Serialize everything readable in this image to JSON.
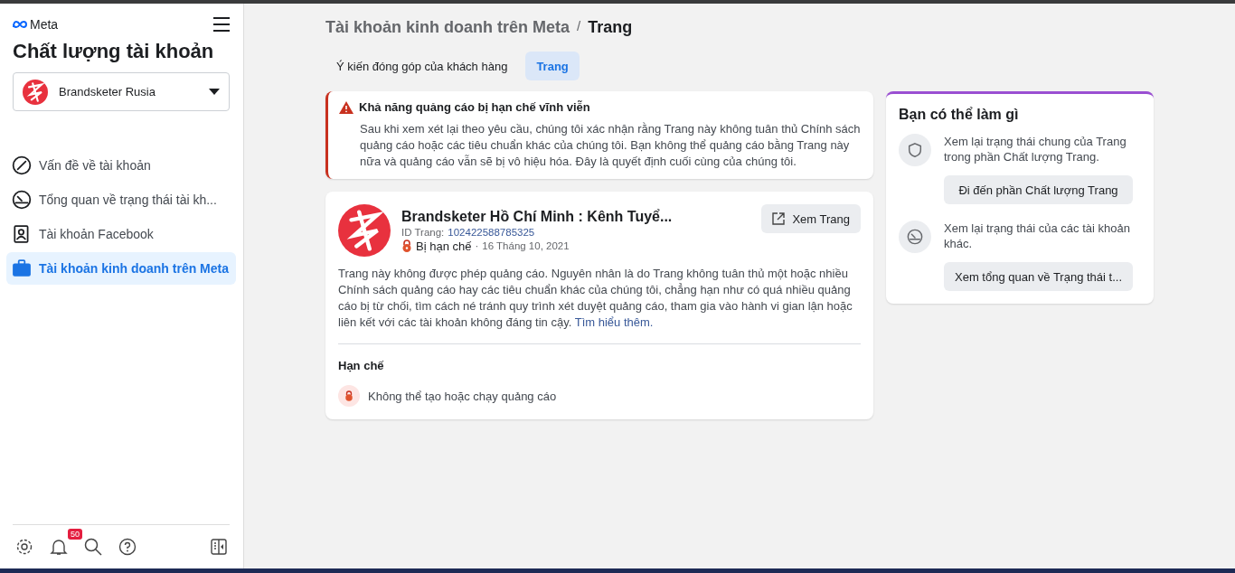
{
  "sidebar": {
    "brand": "Meta",
    "title": "Chất lượng tài khoản",
    "account_picker": {
      "name": "Brandsketer Rusia"
    },
    "items": [
      {
        "label": "Vấn đề về tài khoản",
        "selected": false
      },
      {
        "label": "Tổng quan về trạng thái tài kh...",
        "selected": false
      },
      {
        "label": "Tài khoản Facebook",
        "selected": false
      },
      {
        "label": "Tài khoản kinh doanh trên Meta",
        "selected": true
      }
    ],
    "footer": {
      "notification_count": "50"
    }
  },
  "breadcrumb": {
    "parent": "Tài khoản kinh doanh trên Meta",
    "separator": "/",
    "current": "Trang"
  },
  "tabs": [
    {
      "label": "Ý kiến đóng góp của khách hàng",
      "selected": false
    },
    {
      "label": "Trang",
      "selected": true
    }
  ],
  "alert": {
    "title": "Khả năng quảng cáo bị hạn chế vĩnh viễn",
    "body": "Sau khi xem xét lại theo yêu cầu, chúng tôi xác nhận rằng Trang này không tuân thủ Chính sách quảng cáo hoặc các tiêu chuẩn khác của chúng tôi. Bạn không thể quảng cáo bằng Trang này nữa và quảng cáo vẫn sẽ bị vô hiệu hóa. Đây là quyết định cuối cùng của chúng tôi."
  },
  "page_card": {
    "name": "Brandsketer Hồ Chí Minh : Kênh Tuyể...",
    "id_label": "ID Trang:",
    "id_value": "102422588785325",
    "status": "Bị hạn chế",
    "separator": "·",
    "date": "16 Tháng 10, 2021",
    "view_button": "Xem Trang",
    "description": "Trang này không được phép quảng cáo. Nguyên nhân là do Trang không tuân thủ một hoặc nhiều Chính sách quảng cáo hay các tiêu chuẩn khác của chúng tôi, chẳng hạn như có quá nhiều quảng cáo bị từ chối, tìm cách né tránh quy trình xét duyệt quảng cáo, tham gia vào hành vi gian lận hoặc liên kết với các tài khoản không đáng tin cậy.",
    "learn_more": "Tìm hiểu thêm.",
    "restrictions_title": "Hạn chế",
    "restrictions": [
      "Không thể tạo hoặc chạy quảng cáo"
    ]
  },
  "actions_panel": {
    "title": "Bạn có thể làm gì",
    "items": [
      {
        "text": "Xem lại trạng thái chung của Trang trong phần Chất lượng Trang.",
        "button": "Đi đến phần Chất lượng Trang"
      },
      {
        "text": "Xem lại trạng thái của các tài khoản khác.",
        "button": "Xem tổng quan về Trạng thái t..."
      }
    ]
  }
}
